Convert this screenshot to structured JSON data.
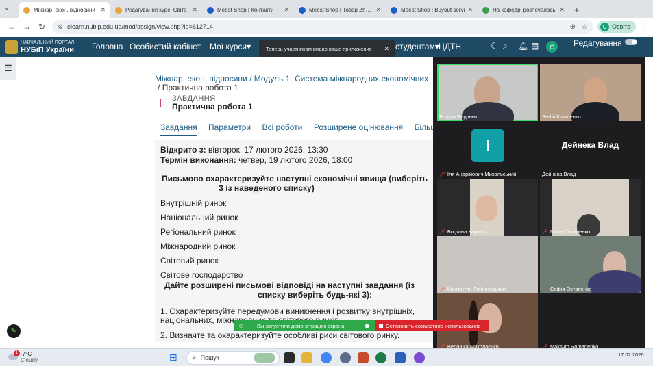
{
  "browser": {
    "tabs": [
      {
        "title": "Міжнар. екон. відносини",
        "active": true,
        "color": "#e8a33a"
      },
      {
        "title": "Редагування курс: Світо",
        "active": false,
        "color": "#e8a33a"
      },
      {
        "title": "Meest Shop | Контакти",
        "active": false,
        "color": "#1a5fc7"
      },
      {
        "title": "Meest Shop | Товар Zheng",
        "active": false,
        "color": "#1a5fc7"
      },
      {
        "title": "Meest Shop | Buyout servi",
        "active": false,
        "color": "#1a5fc7"
      },
      {
        "title": "На кафедрі розпочалась",
        "active": false,
        "color": "#3aa04a"
      }
    ],
    "new_tab": "+",
    "url": "elearn.nubip.edu.ua/mod/assign/view.php?id=612714",
    "profile_initial": "C",
    "profile_label": "Освіта"
  },
  "navbar": {
    "logo_line1": "НАВЧАЛЬНИЙ ПОРТАЛ",
    "logo_line2": "НУБіП України",
    "items": [
      "Головна",
      "Особистий кабінет",
      "Мої курси"
    ],
    "students": "студентам",
    "cdtn": "ЦДТН",
    "user_initial": "C",
    "edit_label": "Редагування"
  },
  "toast": {
    "text": "Теперь участникам видно ваше приложение"
  },
  "breadcrumb": {
    "line1": "Міжнар. екон. відносини / Модуль 1. Система міжнародних економічних",
    "line2_sep": "/",
    "line2": "Практична робота 1"
  },
  "module": {
    "type": "ЗАВДАННЯ",
    "title": "Практична робота 1"
  },
  "subtabs": [
    "Завдання",
    "Параметри",
    "Всі роботи",
    "Розширене оцінювання",
    "Більше"
  ],
  "dates": {
    "opened_label": "Відкрито з:",
    "opened_value": "вівторок, 17 лютого 2026, 13:30",
    "due_label": "Термін виконання:",
    "due_value": "четвер, 19 лютого 2026, 18:00"
  },
  "question": {
    "line1": "Письмово охарактеризуйте наступні економічні явища (виберіть",
    "line2": "3 із наведеного списку)",
    "terms": [
      "Внутрішній ринок",
      "Національний ринок",
      "Регіональний ринок",
      "Міжнародний ринок",
      "Світовий ринок",
      "Світове господарство"
    ]
  },
  "tasks": {
    "head1": "Дайте розширені письмові відповіді на наступні завдання (із",
    "head2": "списку виберіть будь-які 3):",
    "item1_line1": "1. Охарактеризуйте передумови виникнення і розвитку внутрішніх,",
    "item1_line2": "національних, міжнародних та світового ринків.",
    "item2": "2. Визначте та охарактеризуйте особливі риси світового ринку."
  },
  "call": {
    "participants": [
      {
        "name": "Богдан Бердник",
        "muted": false,
        "speaking": true
      },
      {
        "name": "Serhii Kuzmenko",
        "muted": false
      },
      {
        "name": "Іля Андрійович Михальський",
        "muted": true,
        "initial": "І"
      },
      {
        "name": "Дейнека Влад",
        "muted": false,
        "big_name": "Дейнека Влад"
      },
      {
        "name": "Богдана Карась",
        "muted": true
      },
      {
        "name": "Міша Пилипенко",
        "muted": true
      },
      {
        "name": "Костантин Любинецький",
        "muted": true
      },
      {
        "name": "Софія Остапенко",
        "muted": true
      },
      {
        "name": "Вероніка Миколаєнко",
        "muted": true
      },
      {
        "name": "Maksym Romanenko",
        "muted": true
      }
    ]
  },
  "sharebar": {
    "green": "Вы запустили демонстрацию экрана",
    "red": "Остановить совместное использование"
  },
  "taskbar": {
    "badge": "1",
    "temp": "-7°C",
    "weather": "Cloudy",
    "search": "Пошук",
    "date": "17.02.2026"
  }
}
